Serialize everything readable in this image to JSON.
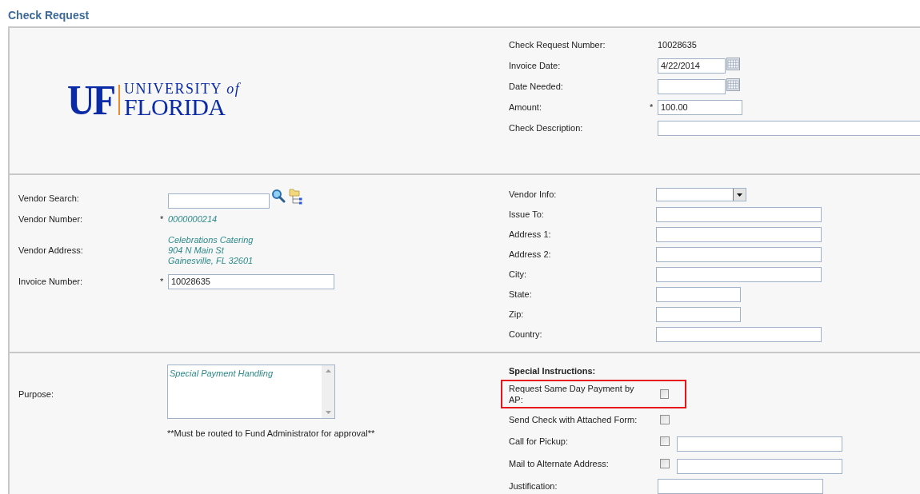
{
  "page_title": "Check Request",
  "logo": {
    "mark": "UF",
    "line1": "UNIVERSITY *of*",
    "line2": "FLORIDA"
  },
  "header_fields": [
    {
      "label": "Check Request Number:",
      "kind": "display",
      "value": "10028635"
    },
    {
      "label": "Invoice Date:",
      "kind": "date",
      "value": "4/22/2014"
    },
    {
      "label": "Date Needed:",
      "kind": "date"
    },
    {
      "label": "Amount:",
      "kind": "short",
      "marker": "*",
      "value": "100.00"
    },
    {
      "label": "Check Description:",
      "kind": "full"
    }
  ],
  "vendor_fields": [
    {
      "label": "Vendor Search:",
      "kind": "search"
    },
    {
      "label": "Vendor Number:",
      "kind": "display",
      "marker": "*",
      "lines": [
        "0000000214"
      ]
    },
    {
      "label": "Vendor Address:",
      "kind": "display",
      "lines": [
        "Celebrations Catering",
        "904 N Main St",
        "Gainesville, FL 32601"
      ]
    },
    {
      "label": "Invoice Number:",
      "kind": "text",
      "marker": "*",
      "value": "10028635"
    }
  ],
  "payee_fields": [
    {
      "label": "Vendor Info:",
      "kind": "select"
    },
    {
      "label": "Issue To:",
      "kind": "text"
    },
    {
      "label": "Address 1:",
      "kind": "text"
    },
    {
      "label": "Address 2:",
      "kind": "text"
    },
    {
      "label": "City:",
      "kind": "text"
    },
    {
      "label": "State:",
      "kind": "short"
    },
    {
      "label": "Zip:",
      "kind": "short"
    },
    {
      "label": "Country:",
      "kind": "text"
    }
  ],
  "purpose": {
    "label": "Purpose:",
    "value": "Special Payment Handling",
    "note": "**Must be routed to Fund Administrator for approval**"
  },
  "special_instructions": {
    "heading": "Special Instructions:",
    "rows": [
      {
        "label": "Request Same Day Payment by AP:",
        "kind": "checkbox",
        "checked": false,
        "highlighted": true
      },
      {
        "label": "Send Check with Attached Form:",
        "kind": "checkbox",
        "checked": false,
        "highlighted": false
      },
      {
        "label": "Call for Pickup:",
        "kind": "checkbox_text",
        "checked": false,
        "highlighted": false
      },
      {
        "label": "Mail to Alternate Address:",
        "kind": "checkbox_text",
        "checked": false,
        "highlighted": false
      },
      {
        "label": "Justification:",
        "kind": "text",
        "highlighted": false
      }
    ]
  }
}
